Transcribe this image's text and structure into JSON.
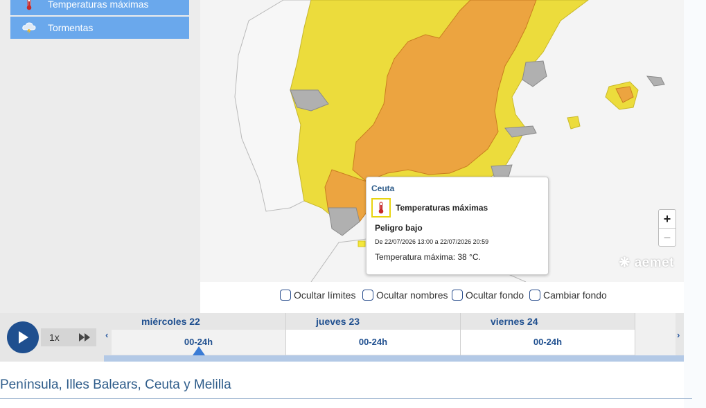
{
  "sidebar": {
    "items": [
      {
        "label": "Temperaturas máximas",
        "icon": "thermometer-icon"
      },
      {
        "label": "Tormentas",
        "icon": "storm-cloud-icon"
      }
    ]
  },
  "map": {
    "zoom_in": "+",
    "zoom_out": "−",
    "logo": "aemet",
    "colors": {
      "yellow": "#ecdc3c",
      "orange": "#eca440",
      "gray": "#b0b0b0",
      "sea": "#f4f4f4"
    }
  },
  "popup": {
    "title": "Ceuta",
    "warning_type": "Temperaturas máximas",
    "level": "Peligro bajo",
    "dates": "De 22/07/2026 13:00 a 22/07/2026 20:59",
    "detail": "Temperatura máxima: 38 °C."
  },
  "checkboxes": [
    {
      "label": "Ocultar límites"
    },
    {
      "label": "Ocultar nombres"
    },
    {
      "label": "Ocultar fondo"
    },
    {
      "label": "Cambiar fondo"
    }
  ],
  "timeline": {
    "speed": "1x",
    "days": [
      {
        "name": "miércoles 22",
        "slot": "00-24h"
      },
      {
        "name": "jueves 23",
        "slot": "00-24h"
      },
      {
        "name": "viernes 24",
        "slot": "00-24h"
      }
    ],
    "prev_arrow": "‹",
    "next_arrow": "›"
  },
  "region_title": "Península, Illes Balears, Ceuta y Melilla"
}
